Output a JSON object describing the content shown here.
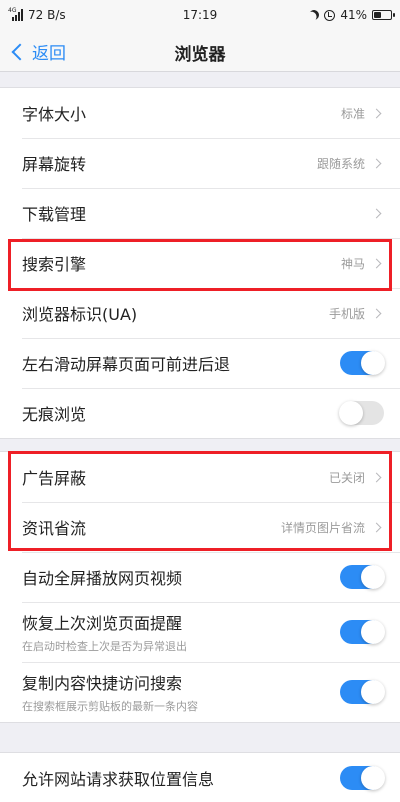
{
  "status_bar": {
    "network_speed": "72 B/s",
    "network_type": "4G",
    "time": "17:19",
    "battery": "41%",
    "battery_level": 0.41
  },
  "header": {
    "back_label": "返回",
    "title": "浏览器"
  },
  "groups": [
    {
      "rows": [
        {
          "label": "字体大小",
          "value": "标准",
          "type": "nav"
        },
        {
          "label": "屏幕旋转",
          "value": "跟随系统",
          "type": "nav"
        },
        {
          "label": "下载管理",
          "value": "",
          "type": "nav"
        },
        {
          "label": "搜索引擎",
          "value": "神马",
          "type": "nav"
        },
        {
          "label": "浏览器标识(UA)",
          "value": "手机版",
          "type": "nav"
        },
        {
          "label": "左右滑动屏幕页面可前进后退",
          "type": "toggle",
          "on": true
        },
        {
          "label": "无痕浏览",
          "type": "toggle",
          "on": false
        }
      ]
    },
    {
      "rows": [
        {
          "label": "广告屏蔽",
          "value": "已关闭",
          "type": "nav"
        },
        {
          "label": "资讯省流",
          "value": "详情页图片省流",
          "type": "nav"
        },
        {
          "label": "自动全屏播放网页视频",
          "type": "toggle",
          "on": true
        },
        {
          "label": "恢复上次浏览页面提醒",
          "sub": "在启动时检查上次是否为异常退出",
          "type": "toggle",
          "on": true
        },
        {
          "label": "复制内容快捷访问搜索",
          "sub": "在搜索框展示剪贴板的最新一条内容",
          "type": "toggle",
          "on": true
        }
      ]
    },
    {
      "rows": [
        {
          "label": "允许网站请求获取位置信息",
          "type": "toggle",
          "on": true
        }
      ]
    }
  ],
  "colors": {
    "accent": "#2c8cf5",
    "highlight": "#ee1f26",
    "background": "#efeff4"
  }
}
